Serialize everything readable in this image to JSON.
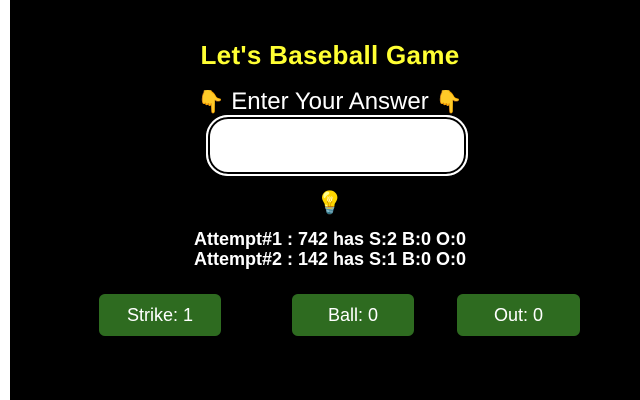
{
  "title": "Let's Baseball Game",
  "prompt": {
    "left_icon": "👇",
    "text": "Enter Your Answer",
    "right_icon": "👇",
    "icon_name": "pointing-hand-icon"
  },
  "answer_input": {
    "value": "",
    "placeholder": ""
  },
  "hint_icon": {
    "glyph": "💡",
    "name": "lightbulb-icon"
  },
  "attempts": [
    "Attempt#1 : 742 has S:2 B:0 O:0",
    "Attempt#2 : 142 has S:1 B:0 O:0"
  ],
  "counters": {
    "strike": "Strike: 1",
    "ball": "Ball: 0",
    "out": "Out: 0"
  },
  "colors": {
    "background": "#000000",
    "title": "#ffff33",
    "button": "#2e6b20"
  }
}
